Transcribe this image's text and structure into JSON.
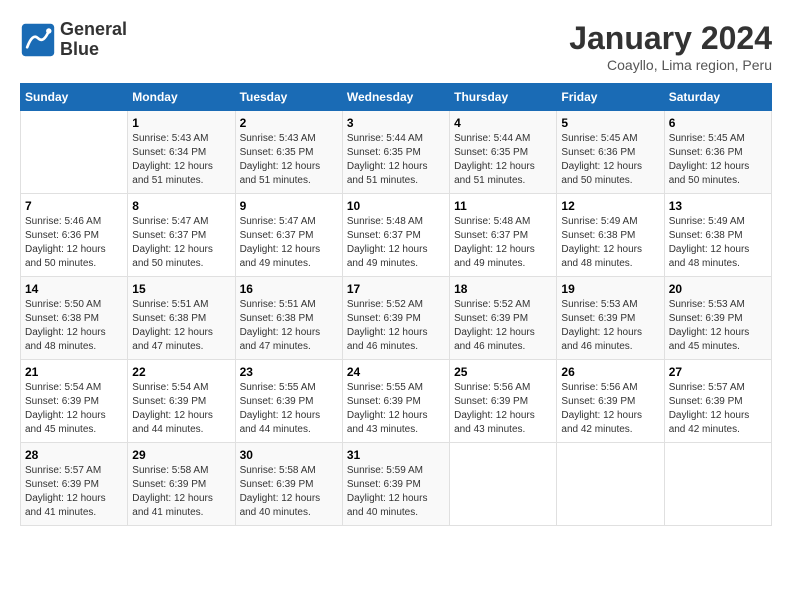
{
  "logo": {
    "line1": "General",
    "line2": "Blue"
  },
  "title": "January 2024",
  "subtitle": "Coayllo, Lima region, Peru",
  "days_of_week": [
    "Sunday",
    "Monday",
    "Tuesday",
    "Wednesday",
    "Thursday",
    "Friday",
    "Saturday"
  ],
  "weeks": [
    [
      {
        "day": "",
        "info": ""
      },
      {
        "day": "1",
        "sunrise": "Sunrise: 5:43 AM",
        "sunset": "Sunset: 6:34 PM",
        "daylight": "Daylight: 12 hours and 51 minutes."
      },
      {
        "day": "2",
        "sunrise": "Sunrise: 5:43 AM",
        "sunset": "Sunset: 6:35 PM",
        "daylight": "Daylight: 12 hours and 51 minutes."
      },
      {
        "day": "3",
        "sunrise": "Sunrise: 5:44 AM",
        "sunset": "Sunset: 6:35 PM",
        "daylight": "Daylight: 12 hours and 51 minutes."
      },
      {
        "day": "4",
        "sunrise": "Sunrise: 5:44 AM",
        "sunset": "Sunset: 6:35 PM",
        "daylight": "Daylight: 12 hours and 51 minutes."
      },
      {
        "day": "5",
        "sunrise": "Sunrise: 5:45 AM",
        "sunset": "Sunset: 6:36 PM",
        "daylight": "Daylight: 12 hours and 50 minutes."
      },
      {
        "day": "6",
        "sunrise": "Sunrise: 5:45 AM",
        "sunset": "Sunset: 6:36 PM",
        "daylight": "Daylight: 12 hours and 50 minutes."
      }
    ],
    [
      {
        "day": "7",
        "sunrise": "Sunrise: 5:46 AM",
        "sunset": "Sunset: 6:36 PM",
        "daylight": "Daylight: 12 hours and 50 minutes."
      },
      {
        "day": "8",
        "sunrise": "Sunrise: 5:47 AM",
        "sunset": "Sunset: 6:37 PM",
        "daylight": "Daylight: 12 hours and 50 minutes."
      },
      {
        "day": "9",
        "sunrise": "Sunrise: 5:47 AM",
        "sunset": "Sunset: 6:37 PM",
        "daylight": "Daylight: 12 hours and 49 minutes."
      },
      {
        "day": "10",
        "sunrise": "Sunrise: 5:48 AM",
        "sunset": "Sunset: 6:37 PM",
        "daylight": "Daylight: 12 hours and 49 minutes."
      },
      {
        "day": "11",
        "sunrise": "Sunrise: 5:48 AM",
        "sunset": "Sunset: 6:37 PM",
        "daylight": "Daylight: 12 hours and 49 minutes."
      },
      {
        "day": "12",
        "sunrise": "Sunrise: 5:49 AM",
        "sunset": "Sunset: 6:38 PM",
        "daylight": "Daylight: 12 hours and 48 minutes."
      },
      {
        "day": "13",
        "sunrise": "Sunrise: 5:49 AM",
        "sunset": "Sunset: 6:38 PM",
        "daylight": "Daylight: 12 hours and 48 minutes."
      }
    ],
    [
      {
        "day": "14",
        "sunrise": "Sunrise: 5:50 AM",
        "sunset": "Sunset: 6:38 PM",
        "daylight": "Daylight: 12 hours and 48 minutes."
      },
      {
        "day": "15",
        "sunrise": "Sunrise: 5:51 AM",
        "sunset": "Sunset: 6:38 PM",
        "daylight": "Daylight: 12 hours and 47 minutes."
      },
      {
        "day": "16",
        "sunrise": "Sunrise: 5:51 AM",
        "sunset": "Sunset: 6:38 PM",
        "daylight": "Daylight: 12 hours and 47 minutes."
      },
      {
        "day": "17",
        "sunrise": "Sunrise: 5:52 AM",
        "sunset": "Sunset: 6:39 PM",
        "daylight": "Daylight: 12 hours and 46 minutes."
      },
      {
        "day": "18",
        "sunrise": "Sunrise: 5:52 AM",
        "sunset": "Sunset: 6:39 PM",
        "daylight": "Daylight: 12 hours and 46 minutes."
      },
      {
        "day": "19",
        "sunrise": "Sunrise: 5:53 AM",
        "sunset": "Sunset: 6:39 PM",
        "daylight": "Daylight: 12 hours and 46 minutes."
      },
      {
        "day": "20",
        "sunrise": "Sunrise: 5:53 AM",
        "sunset": "Sunset: 6:39 PM",
        "daylight": "Daylight: 12 hours and 45 minutes."
      }
    ],
    [
      {
        "day": "21",
        "sunrise": "Sunrise: 5:54 AM",
        "sunset": "Sunset: 6:39 PM",
        "daylight": "Daylight: 12 hours and 45 minutes."
      },
      {
        "day": "22",
        "sunrise": "Sunrise: 5:54 AM",
        "sunset": "Sunset: 6:39 PM",
        "daylight": "Daylight: 12 hours and 44 minutes."
      },
      {
        "day": "23",
        "sunrise": "Sunrise: 5:55 AM",
        "sunset": "Sunset: 6:39 PM",
        "daylight": "Daylight: 12 hours and 44 minutes."
      },
      {
        "day": "24",
        "sunrise": "Sunrise: 5:55 AM",
        "sunset": "Sunset: 6:39 PM",
        "daylight": "Daylight: 12 hours and 43 minutes."
      },
      {
        "day": "25",
        "sunrise": "Sunrise: 5:56 AM",
        "sunset": "Sunset: 6:39 PM",
        "daylight": "Daylight: 12 hours and 43 minutes."
      },
      {
        "day": "26",
        "sunrise": "Sunrise: 5:56 AM",
        "sunset": "Sunset: 6:39 PM",
        "daylight": "Daylight: 12 hours and 42 minutes."
      },
      {
        "day": "27",
        "sunrise": "Sunrise: 5:57 AM",
        "sunset": "Sunset: 6:39 PM",
        "daylight": "Daylight: 12 hours and 42 minutes."
      }
    ],
    [
      {
        "day": "28",
        "sunrise": "Sunrise: 5:57 AM",
        "sunset": "Sunset: 6:39 PM",
        "daylight": "Daylight: 12 hours and 41 minutes."
      },
      {
        "day": "29",
        "sunrise": "Sunrise: 5:58 AM",
        "sunset": "Sunset: 6:39 PM",
        "daylight": "Daylight: 12 hours and 41 minutes."
      },
      {
        "day": "30",
        "sunrise": "Sunrise: 5:58 AM",
        "sunset": "Sunset: 6:39 PM",
        "daylight": "Daylight: 12 hours and 40 minutes."
      },
      {
        "day": "31",
        "sunrise": "Sunrise: 5:59 AM",
        "sunset": "Sunset: 6:39 PM",
        "daylight": "Daylight: 12 hours and 40 minutes."
      },
      {
        "day": "",
        "info": ""
      },
      {
        "day": "",
        "info": ""
      },
      {
        "day": "",
        "info": ""
      }
    ]
  ]
}
